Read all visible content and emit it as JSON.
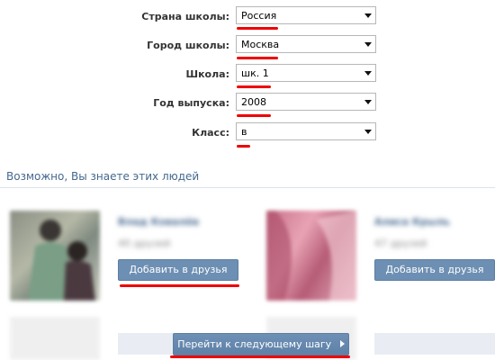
{
  "form": {
    "fields": [
      {
        "label": "Страна школы:",
        "value": "Россия"
      },
      {
        "label": "Город школы:",
        "value": "Москва"
      },
      {
        "label": "Школа:",
        "value": "шк. 1"
      },
      {
        "label": "Год выпуска:",
        "value": "2008"
      },
      {
        "label": "Класс:",
        "value": "в"
      }
    ]
  },
  "suggestions": {
    "title": "Возможно, Вы знаете этих людей",
    "people": [
      {
        "name": "Влад Ковалёв",
        "friends": "40 друзей",
        "button": "Добавить в друзья"
      },
      {
        "name": "Алиса Крыль",
        "friends": "47 друзей",
        "button": "Добавить в друзья"
      }
    ]
  },
  "next_button": "Перейти к следующему шагу",
  "colors": {
    "accent": "#45688e",
    "button": "#6d8fb3",
    "highlight": "#e00000"
  }
}
